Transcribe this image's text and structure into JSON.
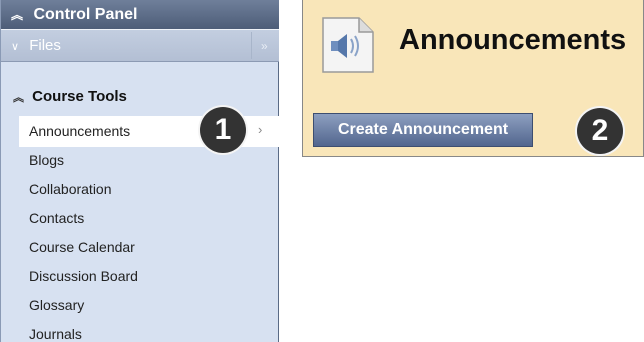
{
  "control_panel": {
    "title": "Control Panel",
    "files_label": "Files",
    "course_tools_title": "Course Tools",
    "items": [
      {
        "label": "Announcements",
        "selected": true
      },
      {
        "label": "Blogs"
      },
      {
        "label": "Collaboration"
      },
      {
        "label": "Contacts"
      },
      {
        "label": "Course Calendar"
      },
      {
        "label": "Discussion Board"
      },
      {
        "label": "Glossary"
      },
      {
        "label": "Journals"
      }
    ]
  },
  "announcements": {
    "title": "Announcements",
    "create_button": "Create Announcement"
  },
  "callouts": [
    "1",
    "2"
  ],
  "icons": {
    "expand_chevron": "double-chevron-up-icon",
    "collapse_chevron": "double-chevron-down-icon",
    "arrow": "chevron-right-icon",
    "page_icon": "speaker-document-icon"
  }
}
